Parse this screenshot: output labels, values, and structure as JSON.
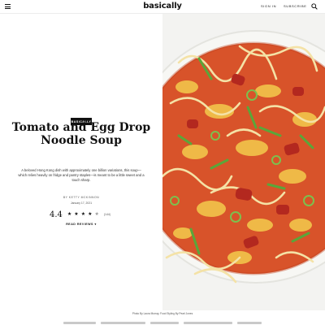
{
  "header": {
    "logo": "basically",
    "sign_in": "SIGN IN",
    "subscribe": "SUBSCRIBE",
    "menu_icon": "hamburger-menu-icon",
    "search_icon": "search-icon"
  },
  "article": {
    "tag": "BASICALLY",
    "title_line1": "Tomato and Egg Drop",
    "title_line2": "Noodle Soup",
    "description": "A beloved Hong Kong dish with approximately one billion variations, this soup—which relies heavily on fridge and pantry staples—is meant to be a little sweet and a touch sharp.",
    "byline": "BY KETTY MCKINNON",
    "date": "January 17, 2021",
    "rating": "4.4",
    "stars_filled": 4.5,
    "star_icon": "star-icon",
    "review_count": "(144)",
    "read_reviews": "READ REVIEWS",
    "photo_credit": "Photo By Laura Murray, Food Styling By Pearl Jones"
  },
  "colors": {
    "background": "#ffffff",
    "text": "#111111",
    "tag_bg": "#111111",
    "broth": "#d8532a",
    "bowl": "#f3f3ef"
  }
}
